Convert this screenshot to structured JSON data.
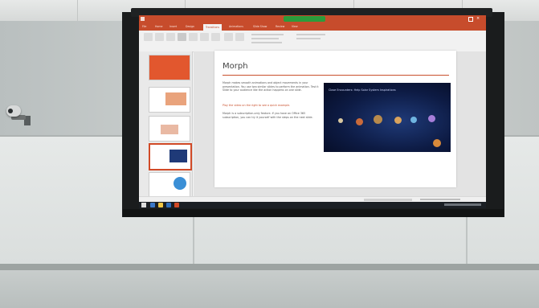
{
  "scene": {
    "description_free": true
  },
  "powerpoint": {
    "tabs": [
      "File",
      "Home",
      "Insert",
      "Design",
      "Transitions",
      "Animations",
      "Slide Show",
      "Review",
      "View"
    ],
    "active_tab": "Transitions",
    "slide": {
      "title": "Morph",
      "paragraphs": [
        "Morph makes smooth animations and object movements in your presentation. You use two similar slides to perform the animation. Test it Slide to your audience like the action happens on one slide.",
        "Play the video on the right to see a quick example.",
        "Morph is a subscription-only feature. If you have an Office 365 subscription, you can try it yourself with the steps on the next slide."
      ],
      "video_caption": "Close Encounters: Help Solar System Inspirations"
    }
  },
  "colors": {
    "accent": "#c74c2c",
    "record": "#2b9c3b",
    "video_bg": "#0d1b44"
  }
}
